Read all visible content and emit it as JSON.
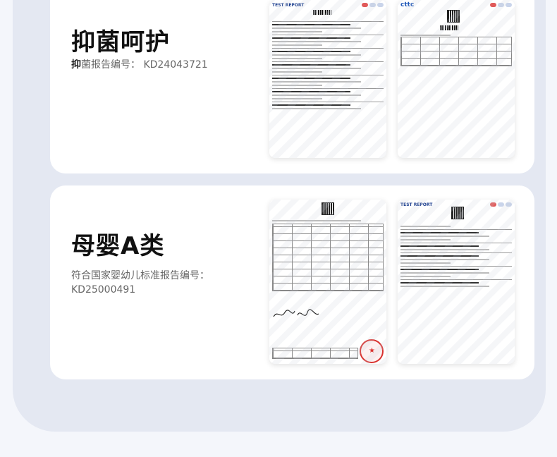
{
  "sections": [
    {
      "title": "抑菌呵护",
      "report_label_bold": "抑",
      "report_label": "菌报告编号：",
      "report_number": "KD24043721"
    },
    {
      "title": "母婴A类",
      "report_label": "符合国家婴幼儿标准报告编号：",
      "report_number": "KD25000491"
    }
  ],
  "documents": {
    "top_left_header": "TEST REPORT",
    "top_right_header": "cttc",
    "bottom_right_header": "TEST REPORT"
  },
  "colors": {
    "card_bg": "#ffffff",
    "outer_bg": "#e4e8f2",
    "page_bg": "#f4f6fb",
    "stamp_red": "#d9322f"
  }
}
